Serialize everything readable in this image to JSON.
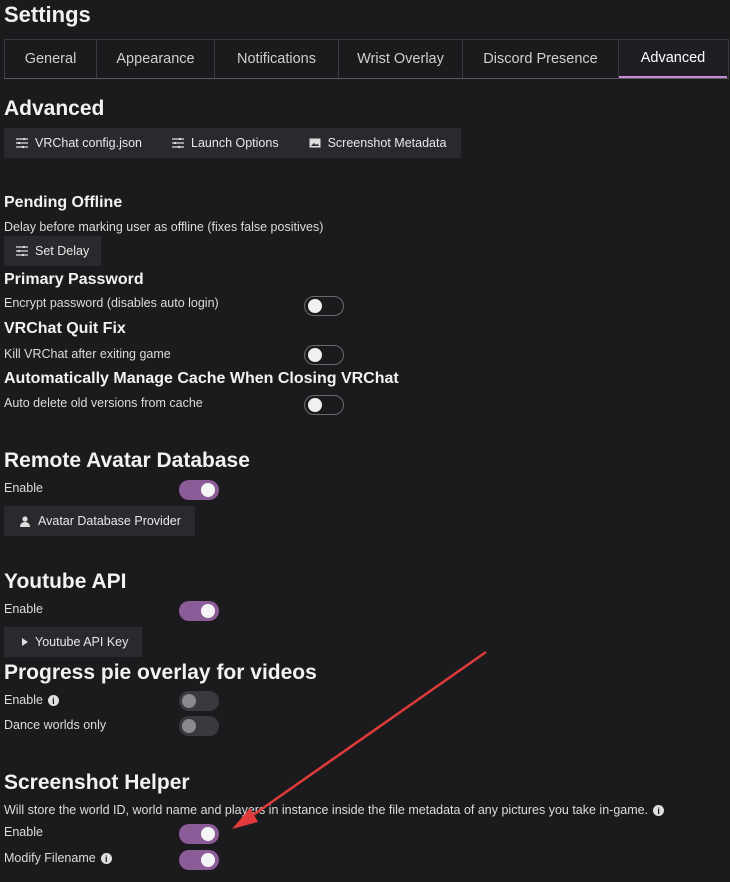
{
  "title": "Settings",
  "tabs": [
    "General",
    "Appearance",
    "Notifications",
    "Wrist Overlay",
    "Discord Presence",
    "Advanced"
  ],
  "advanced": {
    "heading": "Advanced",
    "buttons": [
      "VRChat config.json",
      "Launch Options",
      "Screenshot Metadata"
    ]
  },
  "pending_offline": {
    "heading": "Pending Offline",
    "desc": "Delay before marking user as offline (fixes false positives)",
    "button": "Set Delay"
  },
  "primary_password": {
    "heading": "Primary Password",
    "label": "Encrypt password (disables auto login)",
    "enabled": false
  },
  "quit_fix": {
    "heading": "VRChat Quit Fix",
    "label": "Kill VRChat after exiting game",
    "enabled": false
  },
  "cache": {
    "heading": "Automatically Manage Cache When Closing VRChat",
    "label": "Auto delete old versions from cache",
    "enabled": false
  },
  "remote_avatar": {
    "heading": "Remote Avatar Database",
    "enable_label": "Enable",
    "enabled": true,
    "button": "Avatar Database Provider"
  },
  "youtube": {
    "heading": "Youtube API",
    "enable_label": "Enable",
    "enabled": true,
    "button": "Youtube API Key"
  },
  "progress_pie": {
    "heading": "Progress pie overlay for videos",
    "enable_label": "Enable",
    "dance_label": "Dance worlds only",
    "enabled": false,
    "dance_enabled": false
  },
  "screenshot_helper": {
    "heading": "Screenshot Helper",
    "desc": "Will store the world ID, world name and players in instance inside the file metadata of any pictures you take in-game.",
    "enable_label": "Enable",
    "modify_label": "Modify Filename",
    "enabled": true,
    "modify_enabled": true
  },
  "colors": {
    "accent": "#8c5c98",
    "annotation_arrow": "#e03a3a"
  }
}
